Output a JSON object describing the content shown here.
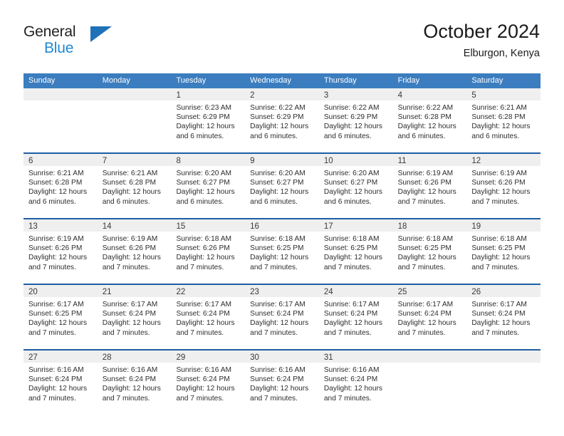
{
  "brand": {
    "name_top": "General",
    "name_bottom": "Blue",
    "triangle_color": "#1f71b8",
    "blue_color": "#1f8ad4"
  },
  "header": {
    "title": "October 2024",
    "location": "Elburgon, Kenya"
  },
  "theme": {
    "header_row_bg": "#3b7dbf",
    "row_divider": "#1e5fa3",
    "date_band_bg": "#efefef",
    "text": "#2d2d2d"
  },
  "weekdays": [
    "Sunday",
    "Monday",
    "Tuesday",
    "Wednesday",
    "Thursday",
    "Friday",
    "Saturday"
  ],
  "weeks": [
    [
      {
        "day": "",
        "empty": true
      },
      {
        "day": "",
        "empty": true
      },
      {
        "day": "1",
        "sunrise": "Sunrise: 6:23 AM",
        "sunset": "Sunset: 6:29 PM",
        "daylight1": "Daylight: 12 hours",
        "daylight2": "and 6 minutes."
      },
      {
        "day": "2",
        "sunrise": "Sunrise: 6:22 AM",
        "sunset": "Sunset: 6:29 PM",
        "daylight1": "Daylight: 12 hours",
        "daylight2": "and 6 minutes."
      },
      {
        "day": "3",
        "sunrise": "Sunrise: 6:22 AM",
        "sunset": "Sunset: 6:29 PM",
        "daylight1": "Daylight: 12 hours",
        "daylight2": "and 6 minutes."
      },
      {
        "day": "4",
        "sunrise": "Sunrise: 6:22 AM",
        "sunset": "Sunset: 6:28 PM",
        "daylight1": "Daylight: 12 hours",
        "daylight2": "and 6 minutes."
      },
      {
        "day": "5",
        "sunrise": "Sunrise: 6:21 AM",
        "sunset": "Sunset: 6:28 PM",
        "daylight1": "Daylight: 12 hours",
        "daylight2": "and 6 minutes."
      }
    ],
    [
      {
        "day": "6",
        "sunrise": "Sunrise: 6:21 AM",
        "sunset": "Sunset: 6:28 PM",
        "daylight1": "Daylight: 12 hours",
        "daylight2": "and 6 minutes."
      },
      {
        "day": "7",
        "sunrise": "Sunrise: 6:21 AM",
        "sunset": "Sunset: 6:28 PM",
        "daylight1": "Daylight: 12 hours",
        "daylight2": "and 6 minutes."
      },
      {
        "day": "8",
        "sunrise": "Sunrise: 6:20 AM",
        "sunset": "Sunset: 6:27 PM",
        "daylight1": "Daylight: 12 hours",
        "daylight2": "and 6 minutes."
      },
      {
        "day": "9",
        "sunrise": "Sunrise: 6:20 AM",
        "sunset": "Sunset: 6:27 PM",
        "daylight1": "Daylight: 12 hours",
        "daylight2": "and 6 minutes."
      },
      {
        "day": "10",
        "sunrise": "Sunrise: 6:20 AM",
        "sunset": "Sunset: 6:27 PM",
        "daylight1": "Daylight: 12 hours",
        "daylight2": "and 6 minutes."
      },
      {
        "day": "11",
        "sunrise": "Sunrise: 6:19 AM",
        "sunset": "Sunset: 6:26 PM",
        "daylight1": "Daylight: 12 hours",
        "daylight2": "and 7 minutes."
      },
      {
        "day": "12",
        "sunrise": "Sunrise: 6:19 AM",
        "sunset": "Sunset: 6:26 PM",
        "daylight1": "Daylight: 12 hours",
        "daylight2": "and 7 minutes."
      }
    ],
    [
      {
        "day": "13",
        "sunrise": "Sunrise: 6:19 AM",
        "sunset": "Sunset: 6:26 PM",
        "daylight1": "Daylight: 12 hours",
        "daylight2": "and 7 minutes."
      },
      {
        "day": "14",
        "sunrise": "Sunrise: 6:19 AM",
        "sunset": "Sunset: 6:26 PM",
        "daylight1": "Daylight: 12 hours",
        "daylight2": "and 7 minutes."
      },
      {
        "day": "15",
        "sunrise": "Sunrise: 6:18 AM",
        "sunset": "Sunset: 6:26 PM",
        "daylight1": "Daylight: 12 hours",
        "daylight2": "and 7 minutes."
      },
      {
        "day": "16",
        "sunrise": "Sunrise: 6:18 AM",
        "sunset": "Sunset: 6:25 PM",
        "daylight1": "Daylight: 12 hours",
        "daylight2": "and 7 minutes."
      },
      {
        "day": "17",
        "sunrise": "Sunrise: 6:18 AM",
        "sunset": "Sunset: 6:25 PM",
        "daylight1": "Daylight: 12 hours",
        "daylight2": "and 7 minutes."
      },
      {
        "day": "18",
        "sunrise": "Sunrise: 6:18 AM",
        "sunset": "Sunset: 6:25 PM",
        "daylight1": "Daylight: 12 hours",
        "daylight2": "and 7 minutes."
      },
      {
        "day": "19",
        "sunrise": "Sunrise: 6:18 AM",
        "sunset": "Sunset: 6:25 PM",
        "daylight1": "Daylight: 12 hours",
        "daylight2": "and 7 minutes."
      }
    ],
    [
      {
        "day": "20",
        "sunrise": "Sunrise: 6:17 AM",
        "sunset": "Sunset: 6:25 PM",
        "daylight1": "Daylight: 12 hours",
        "daylight2": "and 7 minutes."
      },
      {
        "day": "21",
        "sunrise": "Sunrise: 6:17 AM",
        "sunset": "Sunset: 6:24 PM",
        "daylight1": "Daylight: 12 hours",
        "daylight2": "and 7 minutes."
      },
      {
        "day": "22",
        "sunrise": "Sunrise: 6:17 AM",
        "sunset": "Sunset: 6:24 PM",
        "daylight1": "Daylight: 12 hours",
        "daylight2": "and 7 minutes."
      },
      {
        "day": "23",
        "sunrise": "Sunrise: 6:17 AM",
        "sunset": "Sunset: 6:24 PM",
        "daylight1": "Daylight: 12 hours",
        "daylight2": "and 7 minutes."
      },
      {
        "day": "24",
        "sunrise": "Sunrise: 6:17 AM",
        "sunset": "Sunset: 6:24 PM",
        "daylight1": "Daylight: 12 hours",
        "daylight2": "and 7 minutes."
      },
      {
        "day": "25",
        "sunrise": "Sunrise: 6:17 AM",
        "sunset": "Sunset: 6:24 PM",
        "daylight1": "Daylight: 12 hours",
        "daylight2": "and 7 minutes."
      },
      {
        "day": "26",
        "sunrise": "Sunrise: 6:17 AM",
        "sunset": "Sunset: 6:24 PM",
        "daylight1": "Daylight: 12 hours",
        "daylight2": "and 7 minutes."
      }
    ],
    [
      {
        "day": "27",
        "sunrise": "Sunrise: 6:16 AM",
        "sunset": "Sunset: 6:24 PM",
        "daylight1": "Daylight: 12 hours",
        "daylight2": "and 7 minutes."
      },
      {
        "day": "28",
        "sunrise": "Sunrise: 6:16 AM",
        "sunset": "Sunset: 6:24 PM",
        "daylight1": "Daylight: 12 hours",
        "daylight2": "and 7 minutes."
      },
      {
        "day": "29",
        "sunrise": "Sunrise: 6:16 AM",
        "sunset": "Sunset: 6:24 PM",
        "daylight1": "Daylight: 12 hours",
        "daylight2": "and 7 minutes."
      },
      {
        "day": "30",
        "sunrise": "Sunrise: 6:16 AM",
        "sunset": "Sunset: 6:24 PM",
        "daylight1": "Daylight: 12 hours",
        "daylight2": "and 7 minutes."
      },
      {
        "day": "31",
        "sunrise": "Sunrise: 6:16 AM",
        "sunset": "Sunset: 6:24 PM",
        "daylight1": "Daylight: 12 hours",
        "daylight2": "and 7 minutes."
      },
      {
        "day": "",
        "empty": true
      },
      {
        "day": "",
        "empty": true
      }
    ]
  ]
}
